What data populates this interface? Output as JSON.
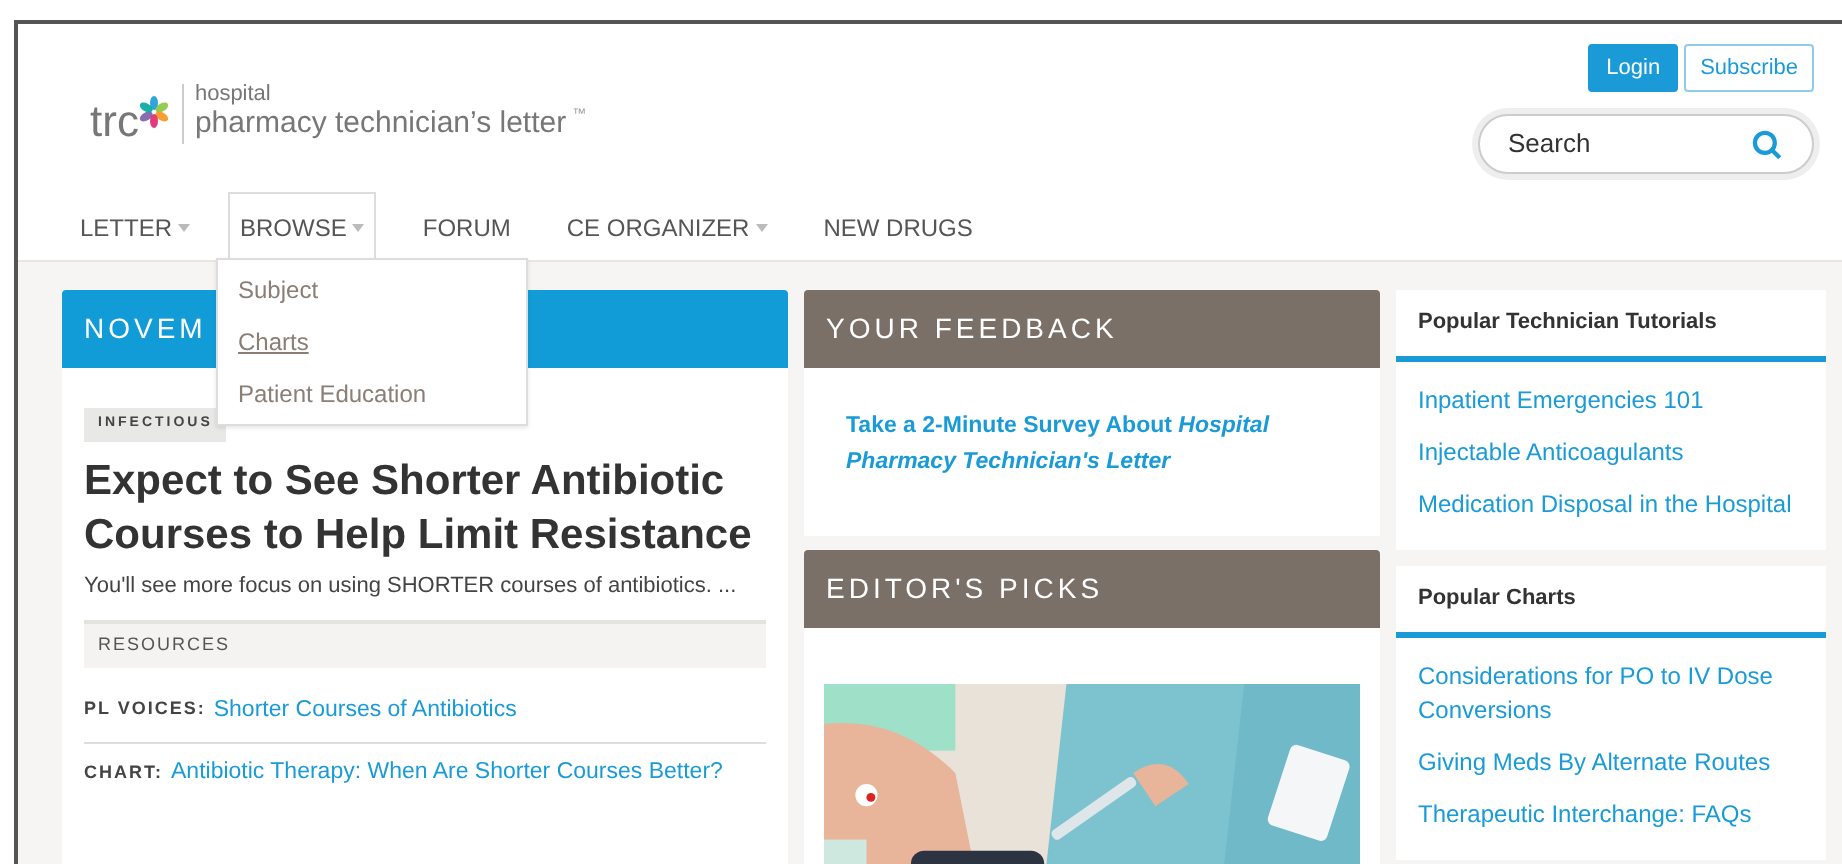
{
  "logo": {
    "brand": "trc",
    "line1": "hospital",
    "line2": "pharmacy technician’s letter",
    "tm": "™"
  },
  "header_buttons": [
    {
      "label": "Login",
      "kind": "primary"
    },
    {
      "label": "Subscribe",
      "kind": "outline"
    }
  ],
  "search": {
    "placeholder": "Search"
  },
  "nav": [
    {
      "label": "LETTER",
      "caret": true,
      "selected": false
    },
    {
      "label": "BROWSE",
      "caret": true,
      "selected": true
    },
    {
      "label": "FORUM",
      "caret": false,
      "selected": false
    },
    {
      "label": "CE ORGANIZER",
      "caret": true,
      "selected": false
    },
    {
      "label": "NEW DRUGS",
      "caret": false,
      "selected": false
    }
  ],
  "dropdown": [
    {
      "label": "Subject",
      "selected": false
    },
    {
      "label": "Charts",
      "selected": true
    },
    {
      "label": "Patient Education",
      "selected": false
    }
  ],
  "issue": {
    "header": "NOVEM",
    "tag": "INFECTIOUS",
    "headline": "Expect to See Shorter Antibiotic Courses to Help Limit Resistance",
    "summary": "You'll see more focus on using SHORTER courses of antibiotics. ...",
    "resources_label": "RESOURCES",
    "resources": [
      {
        "label": "PL VOICES:",
        "link": "Shorter Courses of Antibiotics"
      },
      {
        "label": "CHART:",
        "link": "Antibiotic Therapy: When Are Shorter Courses Better?"
      }
    ]
  },
  "feedback": {
    "header": "YOUR FEEDBACK",
    "link": "Take a 2-Minute Survey About *Hospital Pharmacy Technician's Letter*"
  },
  "editors_picks": {
    "header": "EDITOR'S PICKS"
  },
  "sidebar": [
    {
      "title": "Popular Technician Tutorials",
      "links": [
        "Inpatient Emergencies 101",
        "Injectable Anticoagulants",
        "Medication Disposal in the Hospital"
      ]
    },
    {
      "title": "Popular Charts",
      "links": [
        "Considerations for PO to IV Dose Conversions",
        "Giving Meds By Alternate Routes",
        "Therapeutic Interchange: FAQs"
      ]
    }
  ]
}
